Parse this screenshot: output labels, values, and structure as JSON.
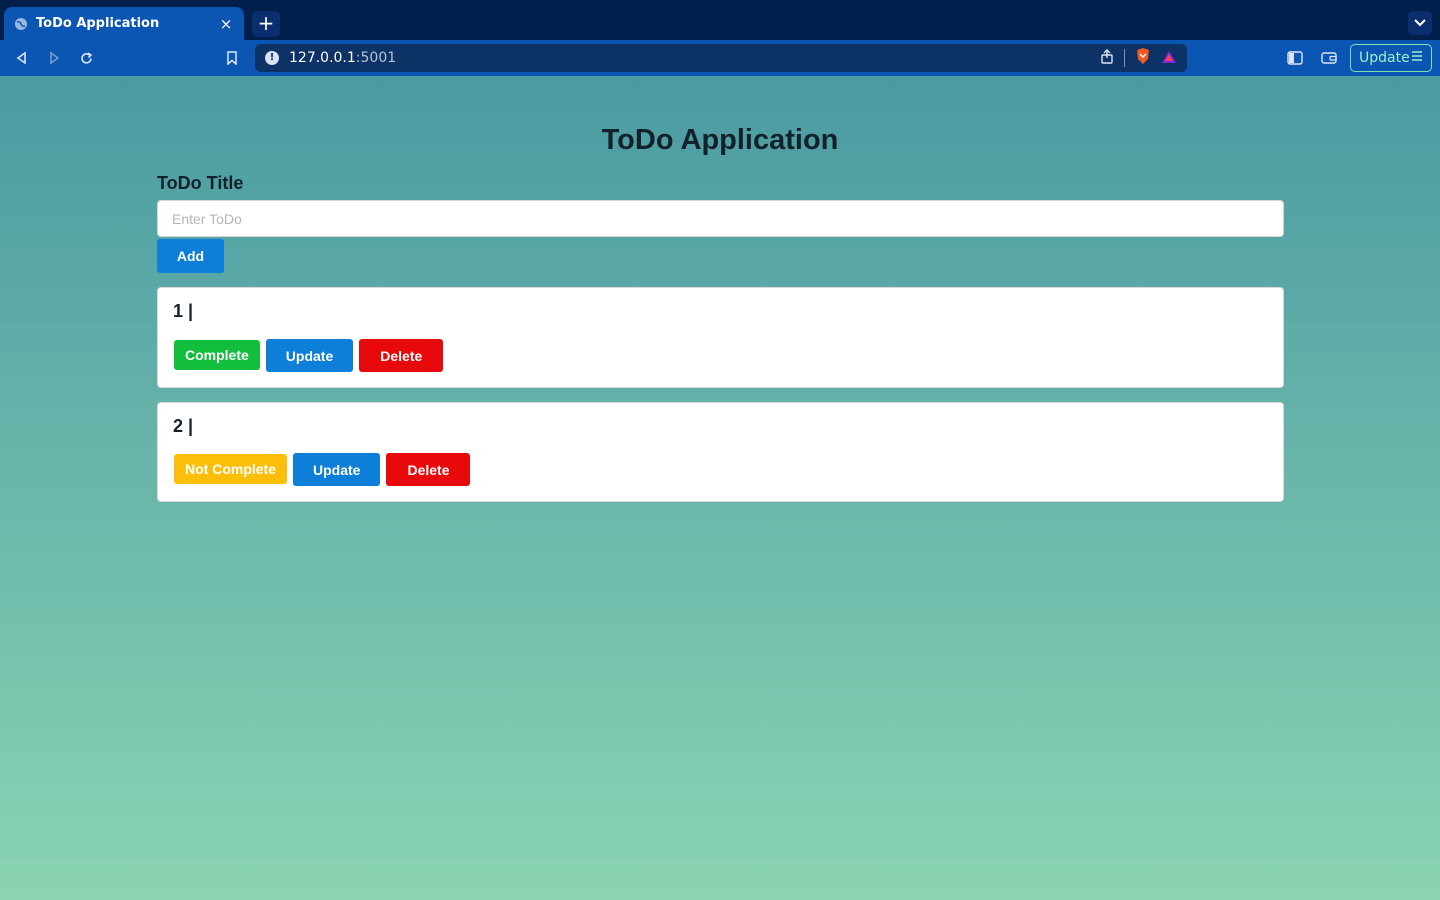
{
  "browser": {
    "tab_title": "ToDo Application",
    "tab_close": "×",
    "new_tab": "+",
    "url_host": "127.0.0.1",
    "url_port": ":5001",
    "url_info": "!",
    "update_label": "Update"
  },
  "app": {
    "title": "ToDo Application",
    "field_label": "ToDo Title",
    "input_placeholder": "Enter ToDo",
    "input_value": "",
    "add_label": "Add"
  },
  "todos": [
    {
      "title": "1 |",
      "status_label": "Complete",
      "update_label": "Update",
      "delete_label": "Delete"
    },
    {
      "title": "2 |",
      "status_label": "Not Complete",
      "update_label": "Update",
      "delete_label": "Delete"
    }
  ],
  "colors": {
    "complete": "#12be3c",
    "not_complete": "#fbbf0a",
    "update": "#0d7fd9",
    "delete": "#e8090d",
    "tab_active": "#0b55b3",
    "tabbar": "#001f4d"
  }
}
